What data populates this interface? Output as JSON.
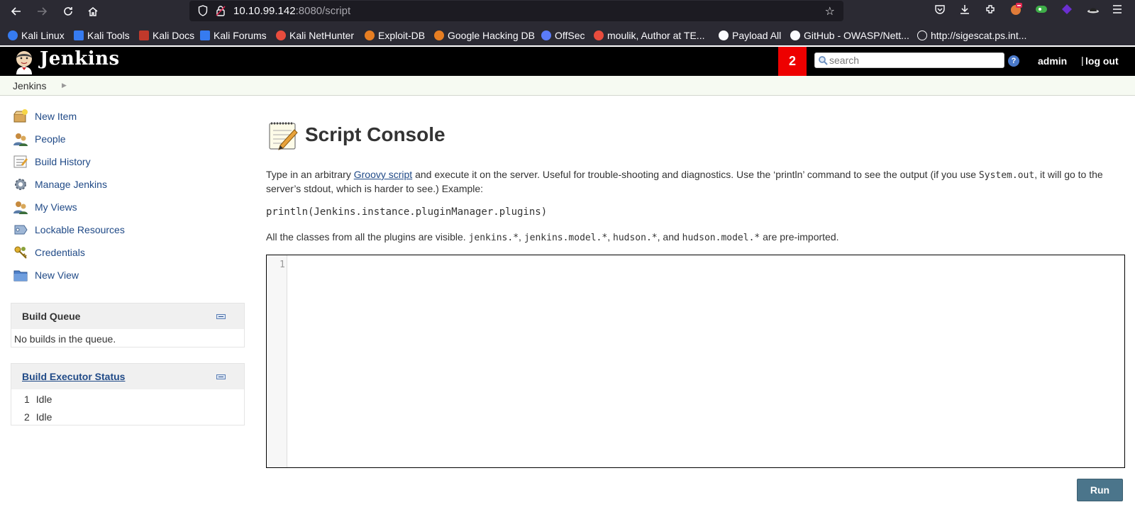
{
  "browser": {
    "url_host": "10.10.99.142",
    "url_path": ":8080/script",
    "bookmarks": [
      {
        "label": "Kali Linux",
        "color": "#367bf0"
      },
      {
        "label": "Kali Tools",
        "color": "#e84c3d"
      },
      {
        "label": "Kali Docs",
        "color": "#c0392b"
      },
      {
        "label": "Kali Forums",
        "color": "#367bf0"
      },
      {
        "label": "Kali NetHunter",
        "color": "#e84c3d"
      },
      {
        "label": "Exploit-DB",
        "color": "#e67e22"
      },
      {
        "label": "Google Hacking DB",
        "color": "#e67e22"
      },
      {
        "label": "OffSec",
        "color": "#5b7cfa"
      },
      {
        "label": "moulik, Author at TE...",
        "color": "#e84c3d"
      },
      {
        "label": "Payload All",
        "color": "#fbfbfe"
      },
      {
        "label": "GitHub - OWASP/Nett...",
        "color": "#fbfbfe"
      },
      {
        "label": "http://sigescat.ps.int...",
        "color": "#fbfbfe"
      }
    ]
  },
  "jenkins": {
    "logo_text": "Jenkins",
    "notification_count": "2",
    "search_placeholder": "search",
    "help": "?",
    "user": "admin",
    "separator": "|",
    "logout": "log out"
  },
  "breadcrumb": {
    "root": "Jenkins"
  },
  "sidebar": {
    "tasks": [
      {
        "label": "New Item",
        "icon": "new-item-icon"
      },
      {
        "label": "People",
        "icon": "people-icon"
      },
      {
        "label": "Build History",
        "icon": "build-history-icon"
      },
      {
        "label": "Manage Jenkins",
        "icon": "gear-icon"
      },
      {
        "label": "My Views",
        "icon": "my-views-icon"
      },
      {
        "label": "Lockable Resources",
        "icon": "lockable-resources-icon"
      },
      {
        "label": "Credentials",
        "icon": "credentials-icon"
      },
      {
        "label": "New View",
        "icon": "folder-icon"
      }
    ],
    "build_queue": {
      "title": "Build Queue",
      "empty_text": "No builds in the queue."
    },
    "executors": {
      "title": "Build Executor Status",
      "items": [
        {
          "number": "1",
          "status": "Idle"
        },
        {
          "number": "2",
          "status": "Idle"
        }
      ]
    }
  },
  "main": {
    "title": "Script Console",
    "intro_1": "Type in an arbitrary ",
    "groovy_link": "Groovy script",
    "intro_2": " and execute it on the server. Useful for trouble-shooting and diagnostics. Use the ‘println’ command to see the output (if you use ",
    "system_out": "System.out",
    "intro_3": ", it will go to the server’s stdout, which is harder to see.) Example:",
    "example_code": "println(Jenkins.instance.pluginManager.plugins)",
    "classes_1": "All the classes from all the plugins are visible. ",
    "pkg_1": "jenkins.*",
    "pkg_2": "jenkins.model.*",
    "pkg_3": "hudson.*",
    "pkg_4": "hudson.model.*",
    "comma": ", ",
    "and": ", and ",
    "classes_2": " are pre-imported.",
    "editor_line": "1",
    "run_label": "Run"
  }
}
